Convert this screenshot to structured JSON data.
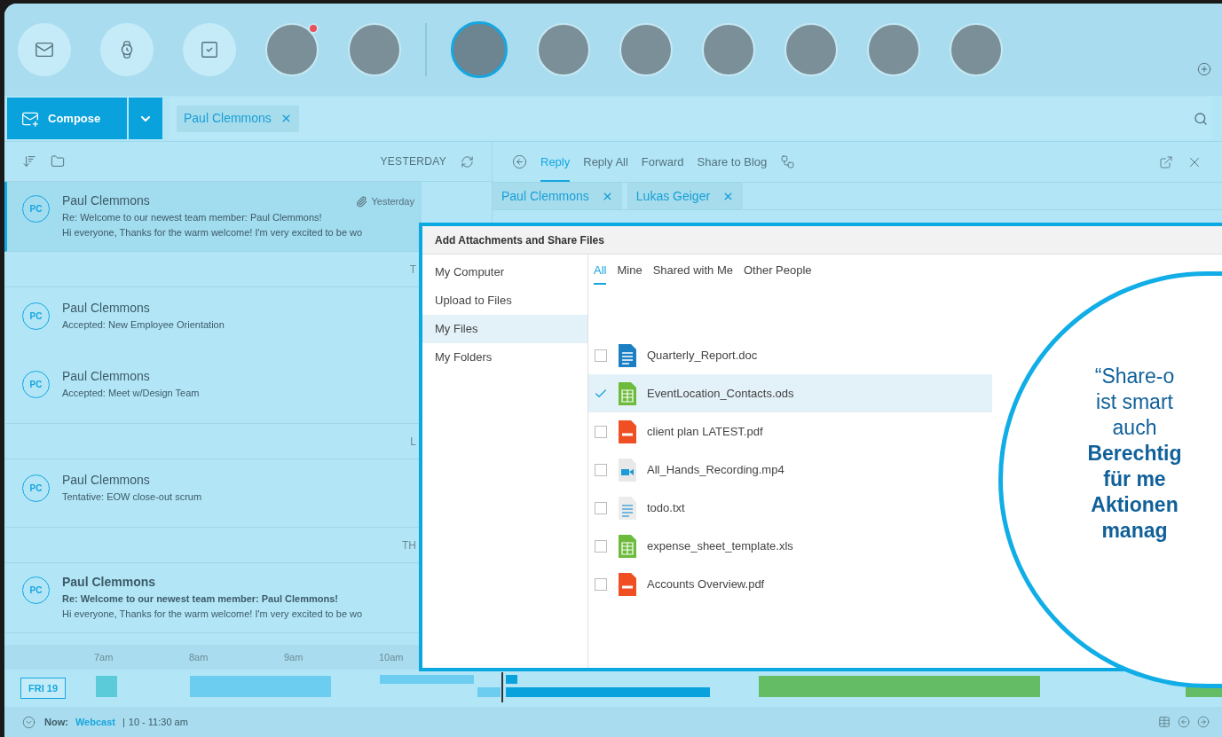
{
  "avatars": [
    {
      "badge": true,
      "selected": false
    },
    {
      "badge": false,
      "selected": false
    },
    {
      "badge": false,
      "selected": true
    },
    {
      "badge": false,
      "selected": false
    },
    {
      "badge": false,
      "selected": false
    },
    {
      "badge": false,
      "selected": false
    },
    {
      "badge": false,
      "selected": false
    },
    {
      "badge": false,
      "selected": false
    },
    {
      "badge": false,
      "selected": false
    }
  ],
  "compose": {
    "label": "Compose"
  },
  "filter_tags": [
    "Paul Clemmons"
  ],
  "list_header": "YESTERDAY",
  "messages": [
    {
      "kind": "message",
      "initials": "PC",
      "sender": "Paul Clemmons",
      "subject": "Re: Welcome to our newest team member: Paul Clemmons!",
      "preview": "Hi everyone, Thanks for the warm welcome! I'm very excited to be wo",
      "time": "Yesterday",
      "attachment": true,
      "selected": true,
      "unread": false
    },
    {
      "kind": "header",
      "label": "T"
    },
    {
      "kind": "message",
      "initials": "PC",
      "sender": "Paul Clemmons",
      "subject": "Accepted: New Employee Orientation",
      "selected": false,
      "unread": false
    },
    {
      "kind": "message",
      "initials": "PC",
      "sender": "Paul Clemmons",
      "subject": "Accepted: Meet w/Design Team",
      "selected": false,
      "unread": false
    },
    {
      "kind": "header",
      "label": "L"
    },
    {
      "kind": "message",
      "initials": "PC",
      "sender": "Paul Clemmons",
      "subject": "Tentative: EOW close-out scrum",
      "selected": false,
      "unread": false
    },
    {
      "kind": "header",
      "label": "TH"
    },
    {
      "kind": "message",
      "initials": "PC",
      "sender": "Paul Clemmons",
      "subject": "Re: Welcome to our newest team member: Paul Clemmons!",
      "preview": "Hi everyone, Thanks for the warm welcome! I'm very excited to be wo",
      "selected": false,
      "unread": true
    }
  ],
  "reader": {
    "actions": [
      {
        "label": "Reply",
        "selected": true
      },
      {
        "label": "Reply All",
        "selected": false
      },
      {
        "label": "Forward",
        "selected": false
      },
      {
        "label": "Share to Blog",
        "selected": false
      }
    ],
    "recipients": [
      "Paul Clemmons",
      "Lukas Geiger"
    ]
  },
  "dialog": {
    "title": "Add Attachments and Share Files",
    "nav": [
      {
        "label": "My Computer",
        "selected": false
      },
      {
        "label": "Upload to Files",
        "selected": false
      },
      {
        "label": "My Files",
        "selected": true
      },
      {
        "label": "My Folders",
        "selected": false
      }
    ],
    "tabs": [
      {
        "label": "All",
        "selected": true
      },
      {
        "label": "Mine",
        "selected": false
      },
      {
        "label": "Shared with Me",
        "selected": false
      },
      {
        "label": "Other People",
        "selected": false
      }
    ],
    "files": [
      {
        "name": "Quarterly_Report.doc",
        "kind": "doc",
        "checked": false
      },
      {
        "name": "EventLocation_Contacts.ods",
        "kind": "sheet",
        "checked": true
      },
      {
        "name": "client plan LATEST.pdf",
        "kind": "pdf",
        "checked": false
      },
      {
        "name": "All_Hands_Recording.mp4",
        "kind": "video",
        "checked": false
      },
      {
        "name": "todo.txt",
        "kind": "text",
        "checked": false
      },
      {
        "name": "expense_sheet_template.xls",
        "kind": "sheet",
        "checked": false
      },
      {
        "name": "Accounts Overview.pdf",
        "kind": "pdf",
        "checked": false
      }
    ]
  },
  "callout": {
    "lines": [
      "“Share-o",
      "ist smart",
      "auch"
    ],
    "bold_lines": [
      "Berechtig",
      "für me",
      "Aktionen",
      "manag"
    ]
  },
  "timeline": {
    "hours": [
      "7am",
      "8am",
      "9am",
      "10am"
    ],
    "day": "FRI 19"
  },
  "status_bar": {
    "label": "Now:",
    "event": "Webcast",
    "separator": "|",
    "time": "10 - 11:30 am"
  }
}
